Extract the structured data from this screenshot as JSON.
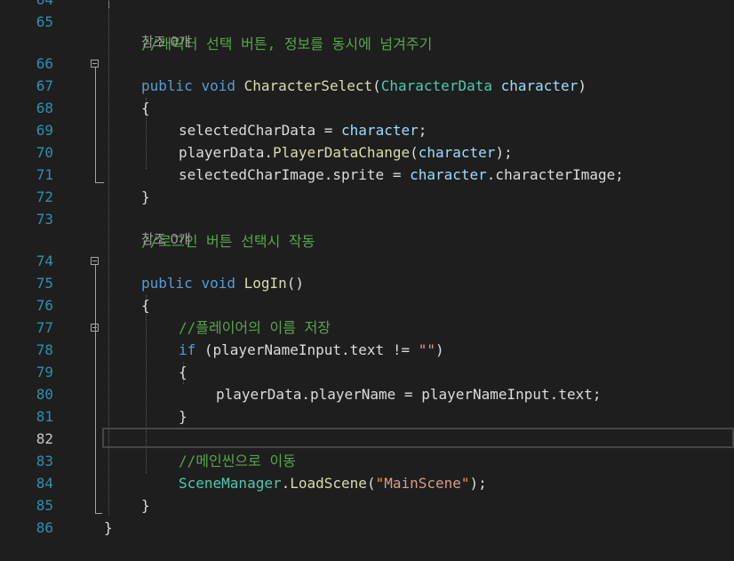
{
  "editor": {
    "top_partial_line_number": "64",
    "lines": [
      {
        "num": "65",
        "text": "        //캐릭터 선택 버튼, 정보를 동시에 넘겨주기"
      },
      {
        "num": "66",
        "text": "        public void CharacterSelect(CharacterData character)"
      },
      {
        "num": "67",
        "text": "        {"
      },
      {
        "num": "68",
        "text": "            selectedCharData = character;"
      },
      {
        "num": "69",
        "text": "            playerData.PlayerDataChange(character);"
      },
      {
        "num": "70",
        "text": "            selectedCharImage.sprite = character.characterImage;"
      },
      {
        "num": "71",
        "text": "        }"
      },
      {
        "num": "72",
        "text": ""
      },
      {
        "num": "73",
        "text": "        //로그인 버튼 선택시 작동"
      },
      {
        "num": "74",
        "text": "        public void LogIn()"
      },
      {
        "num": "75",
        "text": "        {"
      },
      {
        "num": "76",
        "text": "            //플레이어의 이름 저장"
      },
      {
        "num": "77",
        "text": "            if (playerNameInput.text != \"\")"
      },
      {
        "num": "78",
        "text": "            {"
      },
      {
        "num": "79",
        "text": "                playerData.playerName = playerNameInput.text;"
      },
      {
        "num": "80",
        "text": "            }"
      },
      {
        "num": "81",
        "text": ""
      },
      {
        "num": "82",
        "text": "            //메인씬으로 이동"
      },
      {
        "num": "83",
        "text": "            SceneManager.LoadScene(\"MainScene\");"
      },
      {
        "num": "84",
        "text": "        }"
      },
      {
        "num": "85",
        "text": "    }"
      },
      {
        "num": "86",
        "text": ""
      }
    ],
    "reference_hints": [
      "참조 0개",
      "참조 0개"
    ],
    "current_line": "82",
    "colors": {
      "background": "#1e1e1e",
      "line_number": "#2b91af",
      "comment": "#57a64a",
      "keyword": "#569cd6",
      "method": "#dcdcaa",
      "type": "#4ec9b0",
      "parameter": "#9cdcfe",
      "string": "#d69d85",
      "text": "#dcdcdc"
    }
  },
  "tokens": {
    "l65": {
      "cm": "//캐릭터 선택 버튼, 정보를 동시에 넘겨주기"
    },
    "l66": {
      "kw1": "public",
      "kw2": "void",
      "mt": "CharacterSelect",
      "p1": "(",
      "ty": "CharacterData",
      "pm": "character",
      "p2": ")"
    },
    "l67": {
      "t": "{"
    },
    "l68": {
      "t1": "selectedCharData = ",
      "pm": "character",
      "t2": ";"
    },
    "l69": {
      "t1": "playerData.",
      "mt": "PlayerDataChange",
      "p1": "(",
      "pm": "character",
      "p2": ");"
    },
    "l70": {
      "t1": "selectedCharImage.sprite = ",
      "pm": "character",
      "t2": ".characterImage;"
    },
    "l71": {
      "t": "}"
    },
    "l73": {
      "cm": "//로그인 버튼 선택시 작동"
    },
    "l74": {
      "kw1": "public",
      "kw2": "void",
      "mt": "LogIn",
      "p": "()"
    },
    "l75": {
      "t": "{"
    },
    "l76": {
      "cm": "//플레이어의 이름 저장"
    },
    "l77": {
      "kw": "if",
      "t1": " (playerNameInput.text != ",
      "st": "\"\"",
      "t2": ")"
    },
    "l78": {
      "t": "{"
    },
    "l79": {
      "t": "playerData.playerName = playerNameInput.text;"
    },
    "l80": {
      "t": "}"
    },
    "l82": {
      "cm": "//메인씬으로 이동"
    },
    "l83": {
      "ty": "SceneManager",
      "t1": ".",
      "mt": "LoadScene",
      "p1": "(",
      "st": "\"MainScene\"",
      "p2": ");"
    },
    "l84": {
      "t": "}"
    },
    "l85": {
      "t": "}"
    }
  }
}
